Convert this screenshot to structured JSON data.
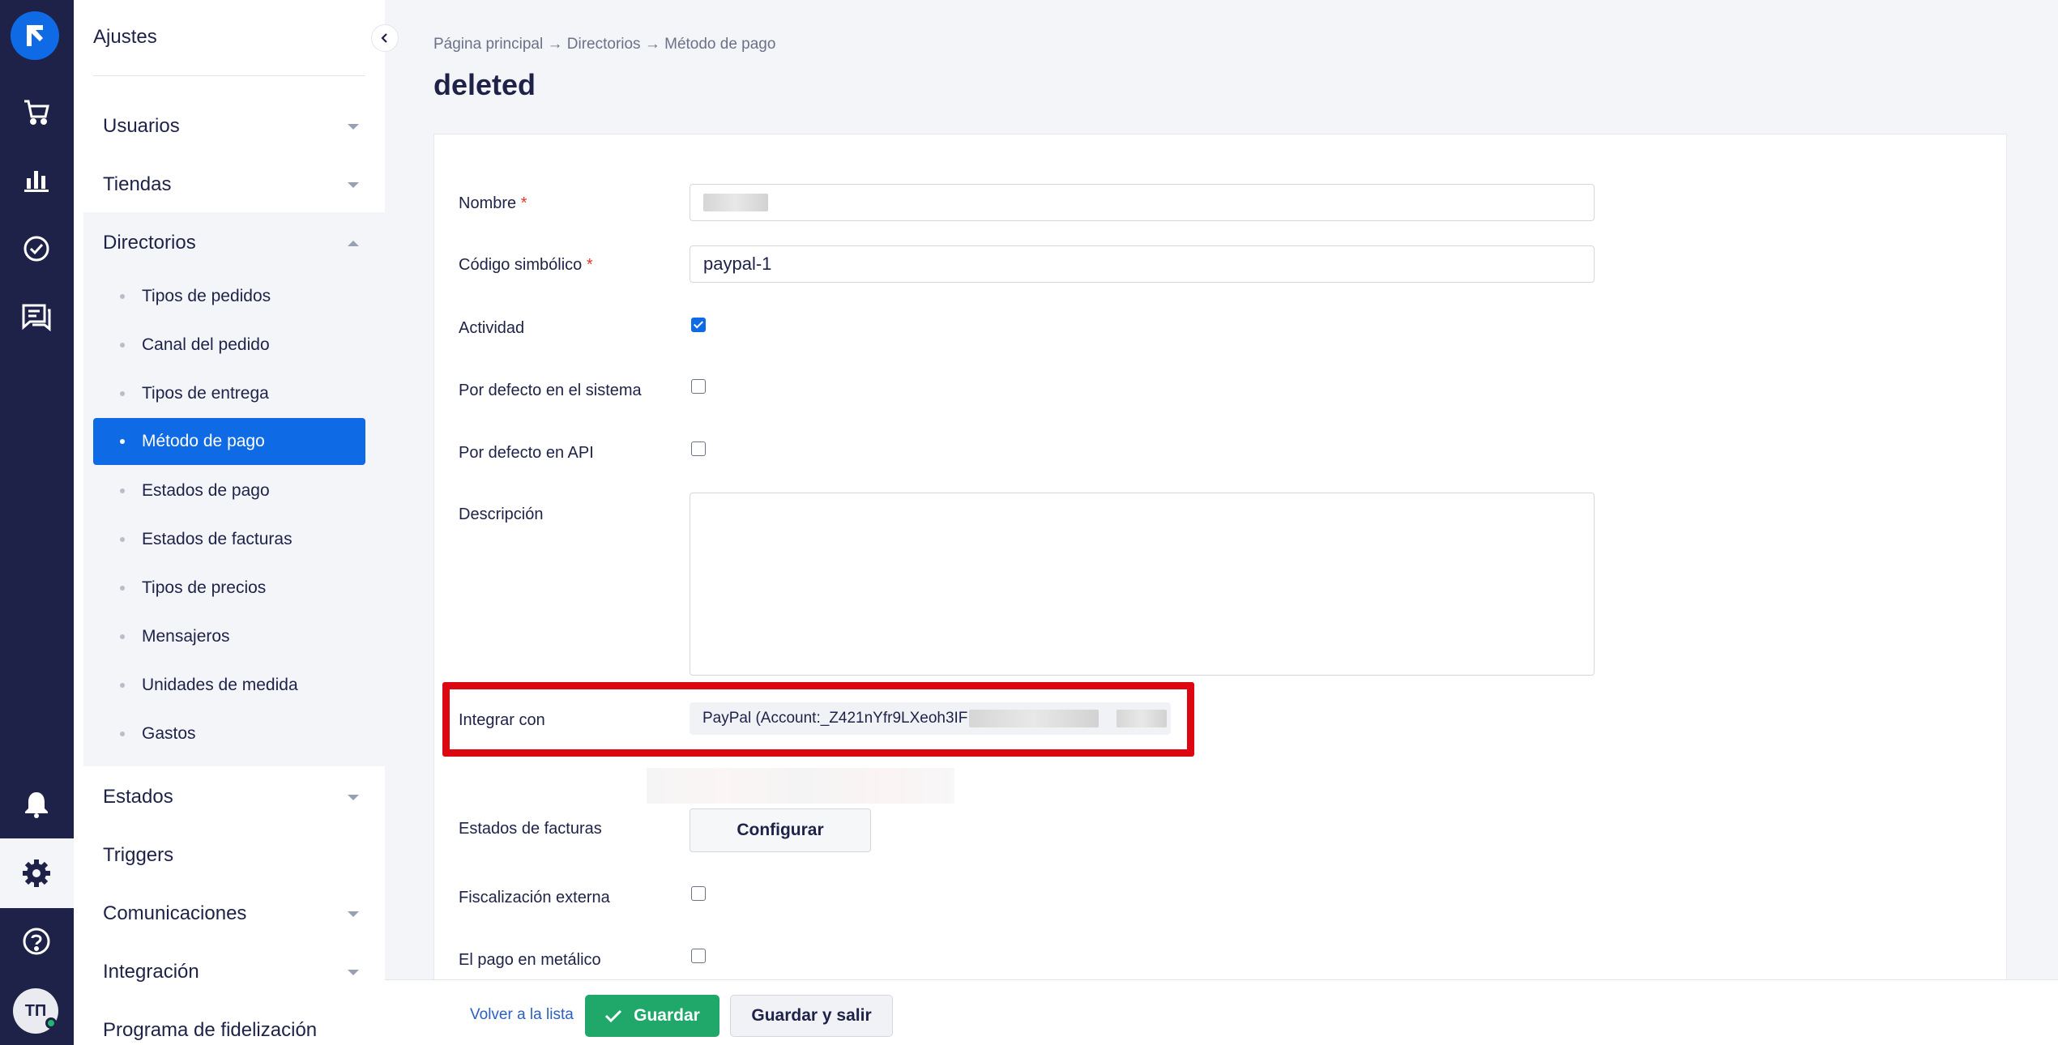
{
  "sidebar": {
    "title": "Ajustes",
    "groups": [
      {
        "label": "Usuarios"
      },
      {
        "label": "Tiendas"
      },
      {
        "label": "Directorios"
      },
      {
        "label": "Estados"
      },
      {
        "label": "Triggers"
      },
      {
        "label": "Comunicaciones"
      },
      {
        "label": "Integración"
      },
      {
        "label": "Programa de fidelización"
      }
    ],
    "directorios_items": [
      {
        "label": "Tipos de pedidos"
      },
      {
        "label": "Canal del pedido"
      },
      {
        "label": "Tipos de entrega"
      },
      {
        "label": "Método de pago"
      },
      {
        "label": "Estados de pago"
      },
      {
        "label": "Estados de facturas"
      },
      {
        "label": "Tipos de precios"
      },
      {
        "label": "Mensajeros"
      },
      {
        "label": "Unidades de medida"
      },
      {
        "label": "Gastos"
      }
    ],
    "active_item": "Método de pago"
  },
  "rail": {
    "icons": [
      "logo-icon",
      "cart-icon",
      "analytics-icon",
      "tasks-icon",
      "chat-icon",
      "bell-icon",
      "settings-icon",
      "help-icon"
    ],
    "avatar_initials": "TП"
  },
  "breadcrumb": "Página principal → Directorios → Método de pago",
  "page_title": "deleted",
  "form": {
    "nombre_label": "Nombre",
    "required_mark": "*",
    "codigo_label": "Código simbólico",
    "codigo_value": "paypal-1",
    "actividad_label": "Actividad",
    "actividad_checked": true,
    "defecto_sistema_label": "Por defecto en el sistema",
    "defecto_api_label": "Por defecto en API",
    "descripcion_label": "Descripción",
    "integrar_label": "Integrar con",
    "integrar_value": "PayPal (Account:_Z421nYfr9LXeoh3IF",
    "estados_facturas_label": "Estados de facturas",
    "configurar_label": "Configurar",
    "fiscalizacion_label": "Fiscalización externa",
    "metalico_label": "El pago en metálico"
  },
  "footer": {
    "back_label": "Volver a la lista",
    "save_label": "Guardar",
    "save_exit_label": "Guardar y salir"
  },
  "colors": {
    "rail": "#1e2248",
    "accent": "#0f6ae6",
    "save": "#20a86b",
    "highlight": "#dd0711"
  }
}
